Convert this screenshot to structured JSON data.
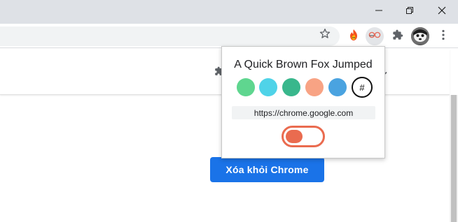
{
  "browser": {
    "window_controls": {
      "minimize_icon": "minimize-icon",
      "restore_icon": "restore-icon",
      "close_icon": "close-icon"
    },
    "toolbar": {
      "bookmark_icon": "star-icon",
      "extensions": [
        "fire-extension-icon",
        "font-extension-icon",
        "puzzle-icon"
      ],
      "profile_icon": "profile-avatar",
      "menu_icon": "more-vert-icon"
    }
  },
  "popup": {
    "title": "A Quick Brown Fox Jumped",
    "swatches": [
      "#5fd68f",
      "#4fd3e8",
      "#39b78c",
      "#f8a384",
      "#4aa3e0"
    ],
    "hash_label": "#",
    "url": "https://chrome.google.com",
    "toggle_on": true,
    "accent_color": "#ea6b4f"
  },
  "page": {
    "remove_button_label": "Xóa khỏi Chrome"
  }
}
